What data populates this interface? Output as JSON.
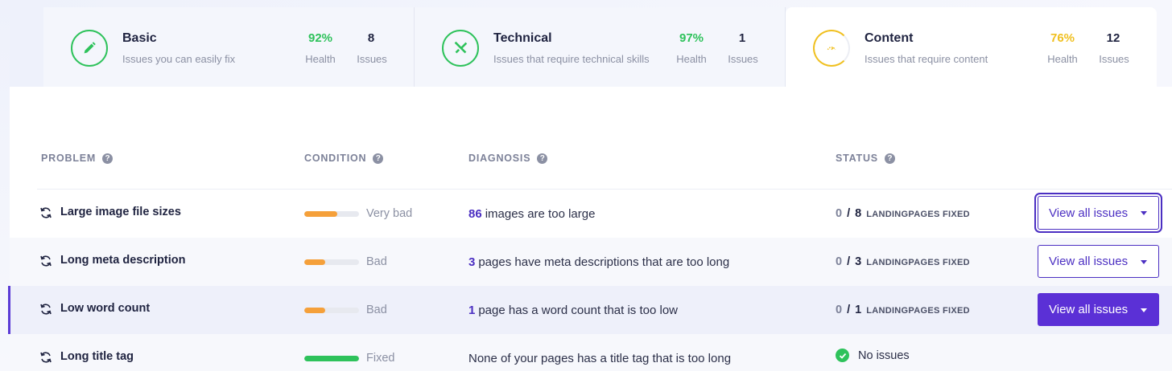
{
  "cards": [
    {
      "title": "Basic",
      "subtitle": "Issues you can easily fix",
      "health": "92%",
      "health_label": "Health",
      "issues": "8",
      "issues_label": "Issues",
      "icon": "pencil-icon",
      "color": "#2ec25b"
    },
    {
      "title": "Technical",
      "subtitle": "Issues that require technical skills",
      "health": "97%",
      "health_label": "Health",
      "issues": "1",
      "issues_label": "Issues",
      "icon": "tools-icon",
      "color": "#2ec25b"
    },
    {
      "title": "Content",
      "subtitle": "Issues that require content",
      "health": "76%",
      "health_label": "Health",
      "issues": "12",
      "issues_label": "Issues",
      "icon": "gauge-icon",
      "color": "#f0c020"
    }
  ],
  "table": {
    "headers": {
      "problem": "PROBLEM",
      "condition": "CONDITION",
      "diagnosis": "DIAGNOSIS",
      "status": "STATUS"
    },
    "help_glyph": "?",
    "rows": [
      {
        "problem": "Large image file sizes",
        "condition": "Very bad",
        "condition_level": 0.6,
        "condition_color": "#f5a03a",
        "diag_num": "86",
        "diag_text": "images are too large",
        "status_fixed": "0",
        "status_slash": "/",
        "status_total": "8",
        "status_label": "LANDINGPAGES FIXED",
        "button": "View all issues"
      },
      {
        "problem": "Long meta description",
        "condition": "Bad",
        "condition_level": 0.38,
        "condition_color": "#f5a03a",
        "diag_num": "3",
        "diag_text": "pages have meta descriptions that are too long",
        "status_fixed": "0",
        "status_slash": "/",
        "status_total": "3",
        "status_label": "LANDINGPAGES FIXED",
        "button": "View all issues"
      },
      {
        "problem": "Low word count",
        "condition": "Bad",
        "condition_level": 0.38,
        "condition_color": "#f5a03a",
        "diag_num": "1",
        "diag_text": "page has a word count that is too low",
        "status_fixed": "0",
        "status_slash": "/",
        "status_total": "1",
        "status_label": "LANDINGPAGES FIXED",
        "button": "View all issues"
      },
      {
        "problem": "Long title tag",
        "condition": "Fixed",
        "condition_level": 1.0,
        "condition_color": "#2ec25b",
        "diag_text": "None of your pages has a title tag that is too long",
        "status_text": "No issues"
      }
    ]
  }
}
